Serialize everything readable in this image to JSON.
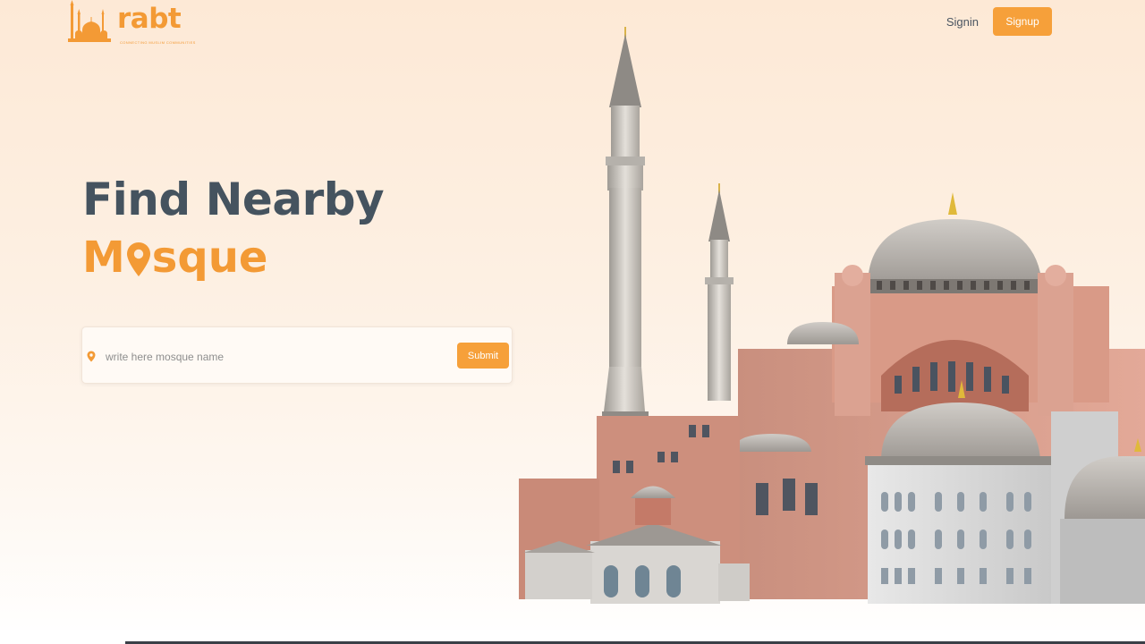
{
  "brand": {
    "name": "rabt",
    "tagline": "CONNECTING MUSLIM COMMUNITIES",
    "accent_color": "#f39a35",
    "logo_icon": "mosque-silhouette-icon"
  },
  "nav": {
    "signin_label": "Signin",
    "signup_label": "Signup"
  },
  "hero": {
    "title_line1": "Find Nearby",
    "title_line2_prefix": "M",
    "title_line2_suffix": "sque",
    "pin_icon": "location-pin-icon"
  },
  "search": {
    "placeholder": "write here mosque name",
    "value": "",
    "submit_label": "Submit",
    "icon": "location-pin-icon"
  },
  "illustration": {
    "subject": "hagia-sophia-mosque-illustration"
  },
  "colors": {
    "heading": "#45535f",
    "accent": "#f39a35",
    "button": "#f6a03a"
  }
}
